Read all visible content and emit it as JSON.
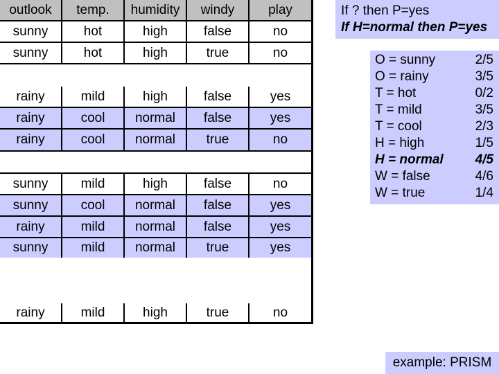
{
  "table": {
    "columns": [
      "outlook",
      "temp.",
      "humidity",
      "windy",
      "play"
    ],
    "rows": [
      [
        "sunny",
        "hot",
        "high",
        "false",
        "no"
      ],
      [
        "sunny",
        "hot",
        "high",
        "true",
        "no"
      ],
      [
        "rainy",
        "mild",
        "high",
        "false",
        "yes"
      ],
      [
        "rainy",
        "cool",
        "normal",
        "false",
        "yes"
      ],
      [
        "rainy",
        "cool",
        "normal",
        "true",
        "no"
      ],
      [
        "sunny",
        "mild",
        "high",
        "false",
        "no"
      ],
      [
        "sunny",
        "cool",
        "normal",
        "false",
        "yes"
      ],
      [
        "rainy",
        "mild",
        "normal",
        "false",
        "yes"
      ],
      [
        "sunny",
        "mild",
        "normal",
        "true",
        "yes"
      ],
      [
        "rainy",
        "mild",
        "high",
        "true",
        "no"
      ]
    ],
    "highlighted_rows": [
      3,
      4,
      6,
      7,
      8
    ],
    "highlight_color": "#ccccff",
    "header_color": "#c0c0c0"
  },
  "rules": {
    "line1": "If ? then P=yes",
    "line2": "If H=normal then P=yes"
  },
  "stats": [
    {
      "label": "O = sunny",
      "value": "2/5"
    },
    {
      "label": "O = rainy",
      "value": "3/5"
    },
    {
      "label": "T = hot",
      "value": "0/2"
    },
    {
      "label": "T = mild",
      "value": "3/5"
    },
    {
      "label": "T = cool",
      "value": "2/3"
    },
    {
      "label": "H = high",
      "value": "1/5"
    },
    {
      "label": "H = normal",
      "value": "4/5",
      "highlight": true
    },
    {
      "label": "W = false",
      "value": "4/6"
    },
    {
      "label": "W = true",
      "value": "1/4"
    }
  ],
  "footer": "example: PRISM"
}
